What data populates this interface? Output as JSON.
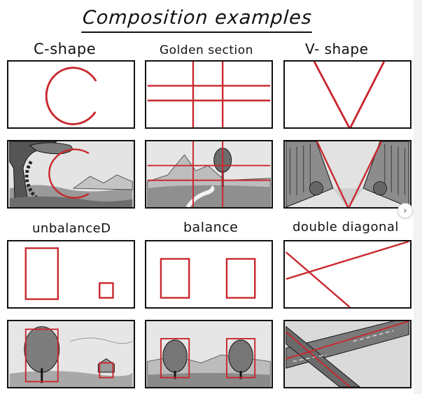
{
  "title": "Composition examples",
  "labels": {
    "c_shape": "C-shape",
    "golden": "Golden section",
    "v_shape": "V- shape",
    "unbalanced": "unbalanceD",
    "balance": "balance",
    "double_diagonal": "double diagonal"
  },
  "icons": {
    "next": "chevron-right-icon"
  },
  "colors": {
    "accent": "#c8282e",
    "ink": "#111111",
    "sketch_bg": "#d9d9d9"
  }
}
